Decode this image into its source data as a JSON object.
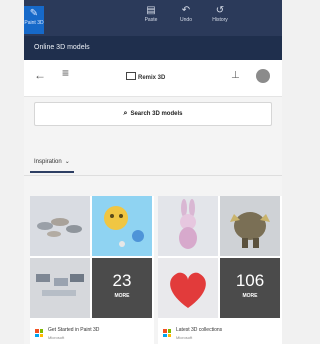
{
  "titlebar": {
    "app_badge_label": "Paint 3D",
    "buttons": [
      {
        "icon": "paste-icon",
        "label": "Paste"
      },
      {
        "icon": "undo-icon",
        "label": "Undo"
      },
      {
        "icon": "history-icon",
        "label": "History"
      }
    ]
  },
  "panel": {
    "title": "Online 3D models"
  },
  "nav": {
    "logo_text": "Remix 3D",
    "search_placeholder": "Search 3D models"
  },
  "filter": {
    "label": "Inspiration"
  },
  "cards": [
    {
      "more_count": "23",
      "more_label": "MORE",
      "title": "Get Started in Paint 3D",
      "subtitle": "Microsoft"
    },
    {
      "more_count": "106",
      "more_label": "MORE",
      "title": "Latest 3D collections",
      "subtitle": "Microsoft"
    }
  ],
  "colors": {
    "titlebar": "#2b3a5a",
    "panel_header": "#1f2f4d",
    "accent": "#1669c9"
  }
}
